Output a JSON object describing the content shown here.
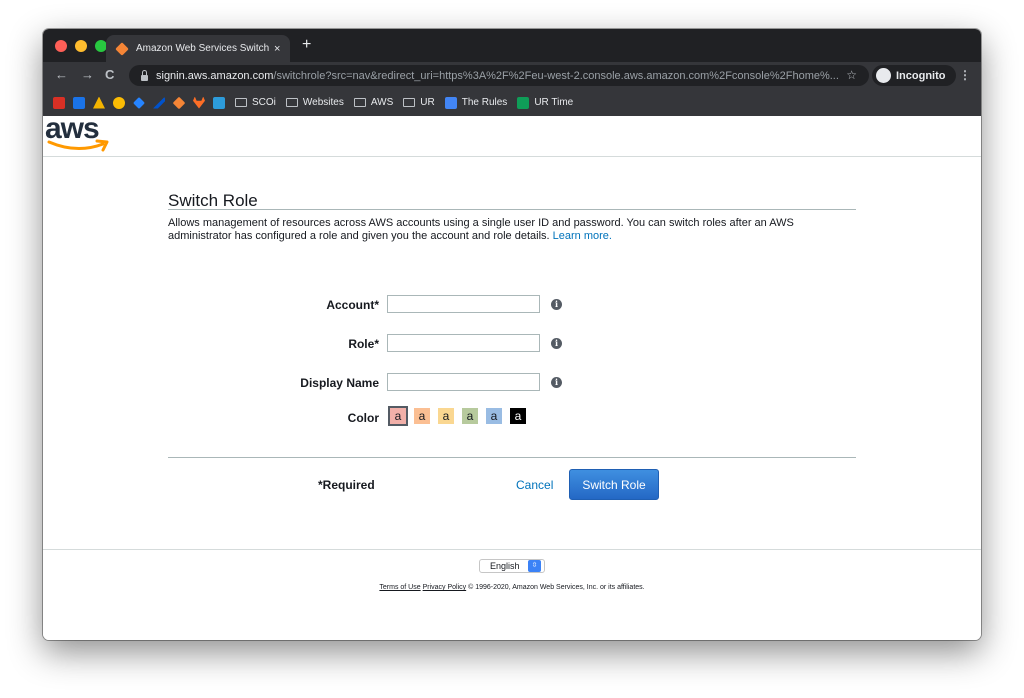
{
  "browser": {
    "tab_title": "Amazon Web Services Switch Ro",
    "tab_close": "×",
    "new_tab": "+",
    "back": "←",
    "forward": "→",
    "reload": "C",
    "url_host": "signin.aws.amazon.com",
    "url_path": "/switchrole?src=nav&redirect_uri=https%3A%2F%2Feu-west-2.console.aws.amazon.com%2Fconsole%2Fhome%...",
    "star": "☆",
    "incognito_label": "Incognito",
    "menu": "⋮",
    "bookmarks": [
      {
        "label": "SCOi"
      },
      {
        "label": "Websites"
      },
      {
        "label": "AWS"
      },
      {
        "label": "UR"
      },
      {
        "label": "The Rules"
      },
      {
        "label": "UR Time"
      }
    ]
  },
  "header": {
    "logo_text": "aws"
  },
  "form": {
    "title": "Switch Role",
    "description": "Allows management of resources across AWS accounts using a single user ID and password. You can switch roles after an AWS administrator has configured a role and given you the account and role details.",
    "learn_more": "Learn more.",
    "account_label": "Account*",
    "account_value": "",
    "role_label": "Role*",
    "role_value": "",
    "display_name_label": "Display Name",
    "display_name_value": "",
    "info_glyph": "i",
    "color_label": "Color",
    "colors": [
      {
        "letter": "a",
        "hex": "#f2b0a9"
      },
      {
        "letter": "a",
        "hex": "#fbbf93"
      },
      {
        "letter": "a",
        "hex": "#fad791"
      },
      {
        "letter": "a",
        "hex": "#b7ca9d"
      },
      {
        "letter": "a",
        "hex": "#99bcE3"
      },
      {
        "letter": "a",
        "hex": "#000000"
      }
    ],
    "required_note": "*Required",
    "cancel_label": "Cancel",
    "submit_label": "Switch Role"
  },
  "footer": {
    "language": "English",
    "terms": "Terms of Use",
    "privacy": "Privacy Policy",
    "copyright": "© 1996-2020, Amazon Web Services, Inc. or its affiliates."
  }
}
